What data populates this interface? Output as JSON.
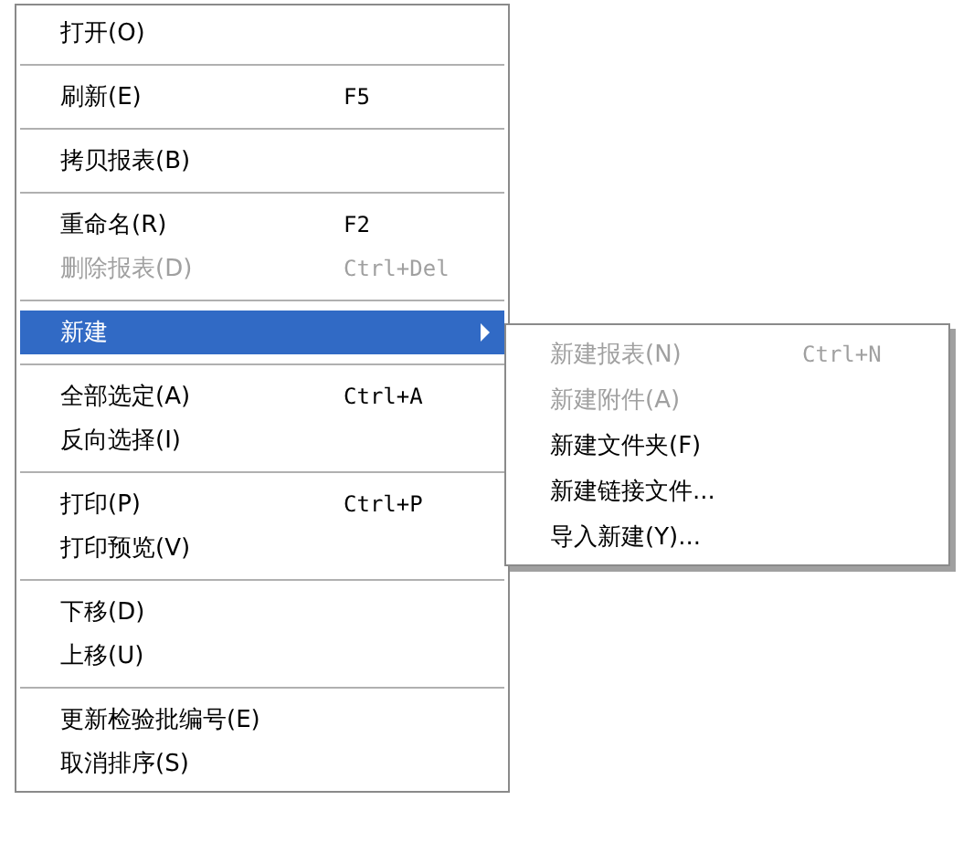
{
  "context_menu": {
    "items": [
      {
        "kind": "item",
        "label": "打开(O)",
        "disabled": false,
        "selected": false
      },
      {
        "kind": "separator"
      },
      {
        "kind": "item",
        "label": "刷新(E)",
        "shortcut": "F5",
        "disabled": false,
        "selected": false
      },
      {
        "kind": "separator"
      },
      {
        "kind": "item",
        "label": "拷贝报表(B)",
        "disabled": false,
        "selected": false
      },
      {
        "kind": "separator"
      },
      {
        "kind": "item",
        "label": "重命名(R)",
        "shortcut": "F2",
        "disabled": false,
        "selected": false
      },
      {
        "kind": "item",
        "label": "删除报表(D)",
        "shortcut": "Ctrl+Del",
        "disabled": true,
        "selected": false
      },
      {
        "kind": "separator"
      },
      {
        "kind": "submenu",
        "label": "新建",
        "disabled": false,
        "selected": true
      },
      {
        "kind": "separator"
      },
      {
        "kind": "item",
        "label": "全部选定(A)",
        "shortcut": "Ctrl+A",
        "disabled": false,
        "selected": false
      },
      {
        "kind": "item",
        "label": "反向选择(I)",
        "disabled": false,
        "selected": false
      },
      {
        "kind": "separator"
      },
      {
        "kind": "item",
        "label": "打印(P)",
        "shortcut": "Ctrl+P",
        "disabled": false,
        "selected": false
      },
      {
        "kind": "item",
        "label": "打印预览(V)",
        "disabled": false,
        "selected": false
      },
      {
        "kind": "separator"
      },
      {
        "kind": "item",
        "label": "下移(D)",
        "disabled": false,
        "selected": false
      },
      {
        "kind": "item",
        "label": "上移(U)",
        "disabled": false,
        "selected": false
      },
      {
        "kind": "separator"
      },
      {
        "kind": "item",
        "label": "更新检验批编号(E)",
        "disabled": false,
        "selected": false
      },
      {
        "kind": "item",
        "label": "取消排序(S)",
        "disabled": false,
        "selected": false
      }
    ]
  },
  "submenu": {
    "items": [
      {
        "kind": "item",
        "label": "新建报表(N)",
        "shortcut": "Ctrl+N",
        "disabled": true,
        "selected": false
      },
      {
        "kind": "item",
        "label": "新建附件(A)",
        "disabled": true,
        "selected": false
      },
      {
        "kind": "item",
        "label": "新建文件夹(F)",
        "disabled": false,
        "selected": false
      },
      {
        "kind": "item",
        "label": "新建链接文件...",
        "disabled": false,
        "selected": false
      },
      {
        "kind": "item",
        "label": "导入新建(Y)...",
        "disabled": false,
        "selected": false
      }
    ]
  }
}
